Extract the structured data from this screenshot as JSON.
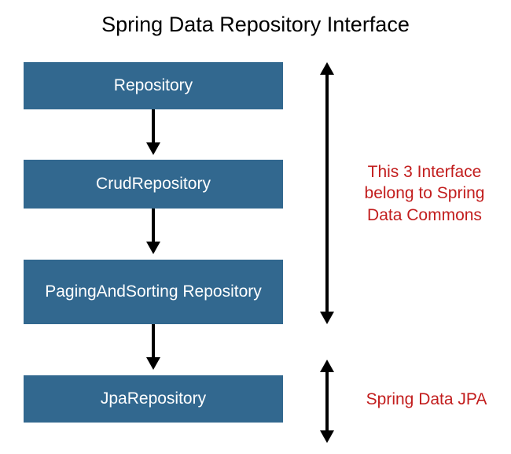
{
  "title": "Spring Data Repository Interface",
  "boxes": {
    "repository": "Repository",
    "crud": "CrudRepository",
    "paging": "PagingAndSorting Repository",
    "jpa": "JpaRepository"
  },
  "annotations": {
    "commons": "This 3 Interface belong to Spring Data Commons",
    "jpa": "Spring Data JPA"
  },
  "colors": {
    "box_bg": "#32688f",
    "box_fg": "#ffffff",
    "annotation": "#c21d1d"
  }
}
